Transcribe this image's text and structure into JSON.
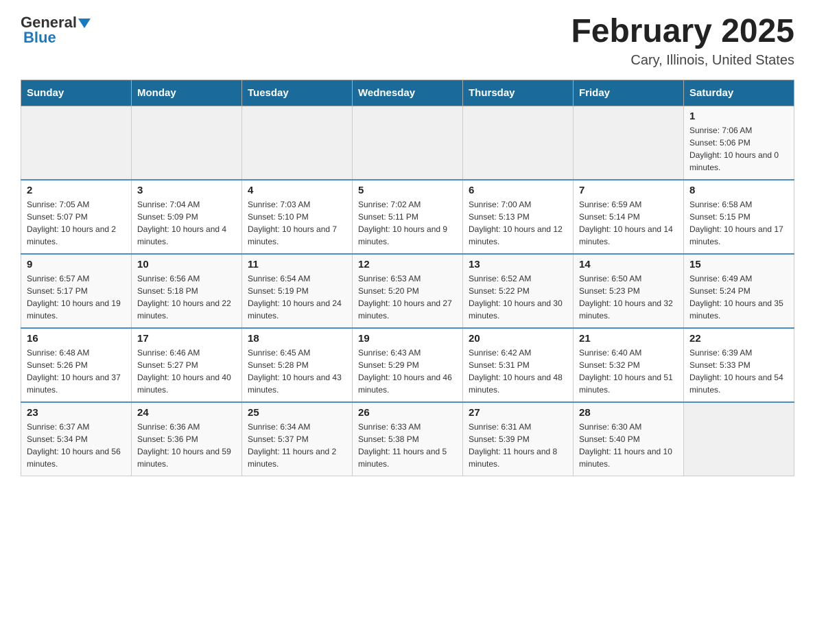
{
  "header": {
    "logo": {
      "general": "General",
      "blue": "Blue",
      "triangle": true
    },
    "title": "February 2025",
    "subtitle": "Cary, Illinois, United States"
  },
  "calendar": {
    "days_of_week": [
      "Sunday",
      "Monday",
      "Tuesday",
      "Wednesday",
      "Thursday",
      "Friday",
      "Saturday"
    ],
    "weeks": [
      {
        "days": [
          {
            "date": "",
            "info": ""
          },
          {
            "date": "",
            "info": ""
          },
          {
            "date": "",
            "info": ""
          },
          {
            "date": "",
            "info": ""
          },
          {
            "date": "",
            "info": ""
          },
          {
            "date": "",
            "info": ""
          },
          {
            "date": "1",
            "info": "Sunrise: 7:06 AM\nSunset: 5:06 PM\nDaylight: 10 hours and 0 minutes."
          }
        ]
      },
      {
        "days": [
          {
            "date": "2",
            "info": "Sunrise: 7:05 AM\nSunset: 5:07 PM\nDaylight: 10 hours and 2 minutes."
          },
          {
            "date": "3",
            "info": "Sunrise: 7:04 AM\nSunset: 5:09 PM\nDaylight: 10 hours and 4 minutes."
          },
          {
            "date": "4",
            "info": "Sunrise: 7:03 AM\nSunset: 5:10 PM\nDaylight: 10 hours and 7 minutes."
          },
          {
            "date": "5",
            "info": "Sunrise: 7:02 AM\nSunset: 5:11 PM\nDaylight: 10 hours and 9 minutes."
          },
          {
            "date": "6",
            "info": "Sunrise: 7:00 AM\nSunset: 5:13 PM\nDaylight: 10 hours and 12 minutes."
          },
          {
            "date": "7",
            "info": "Sunrise: 6:59 AM\nSunset: 5:14 PM\nDaylight: 10 hours and 14 minutes."
          },
          {
            "date": "8",
            "info": "Sunrise: 6:58 AM\nSunset: 5:15 PM\nDaylight: 10 hours and 17 minutes."
          }
        ]
      },
      {
        "days": [
          {
            "date": "9",
            "info": "Sunrise: 6:57 AM\nSunset: 5:17 PM\nDaylight: 10 hours and 19 minutes."
          },
          {
            "date": "10",
            "info": "Sunrise: 6:56 AM\nSunset: 5:18 PM\nDaylight: 10 hours and 22 minutes."
          },
          {
            "date": "11",
            "info": "Sunrise: 6:54 AM\nSunset: 5:19 PM\nDaylight: 10 hours and 24 minutes."
          },
          {
            "date": "12",
            "info": "Sunrise: 6:53 AM\nSunset: 5:20 PM\nDaylight: 10 hours and 27 minutes."
          },
          {
            "date": "13",
            "info": "Sunrise: 6:52 AM\nSunset: 5:22 PM\nDaylight: 10 hours and 30 minutes."
          },
          {
            "date": "14",
            "info": "Sunrise: 6:50 AM\nSunset: 5:23 PM\nDaylight: 10 hours and 32 minutes."
          },
          {
            "date": "15",
            "info": "Sunrise: 6:49 AM\nSunset: 5:24 PM\nDaylight: 10 hours and 35 minutes."
          }
        ]
      },
      {
        "days": [
          {
            "date": "16",
            "info": "Sunrise: 6:48 AM\nSunset: 5:26 PM\nDaylight: 10 hours and 37 minutes."
          },
          {
            "date": "17",
            "info": "Sunrise: 6:46 AM\nSunset: 5:27 PM\nDaylight: 10 hours and 40 minutes."
          },
          {
            "date": "18",
            "info": "Sunrise: 6:45 AM\nSunset: 5:28 PM\nDaylight: 10 hours and 43 minutes."
          },
          {
            "date": "19",
            "info": "Sunrise: 6:43 AM\nSunset: 5:29 PM\nDaylight: 10 hours and 46 minutes."
          },
          {
            "date": "20",
            "info": "Sunrise: 6:42 AM\nSunset: 5:31 PM\nDaylight: 10 hours and 48 minutes."
          },
          {
            "date": "21",
            "info": "Sunrise: 6:40 AM\nSunset: 5:32 PM\nDaylight: 10 hours and 51 minutes."
          },
          {
            "date": "22",
            "info": "Sunrise: 6:39 AM\nSunset: 5:33 PM\nDaylight: 10 hours and 54 minutes."
          }
        ]
      },
      {
        "days": [
          {
            "date": "23",
            "info": "Sunrise: 6:37 AM\nSunset: 5:34 PM\nDaylight: 10 hours and 56 minutes."
          },
          {
            "date": "24",
            "info": "Sunrise: 6:36 AM\nSunset: 5:36 PM\nDaylight: 10 hours and 59 minutes."
          },
          {
            "date": "25",
            "info": "Sunrise: 6:34 AM\nSunset: 5:37 PM\nDaylight: 11 hours and 2 minutes."
          },
          {
            "date": "26",
            "info": "Sunrise: 6:33 AM\nSunset: 5:38 PM\nDaylight: 11 hours and 5 minutes."
          },
          {
            "date": "27",
            "info": "Sunrise: 6:31 AM\nSunset: 5:39 PM\nDaylight: 11 hours and 8 minutes."
          },
          {
            "date": "28",
            "info": "Sunrise: 6:30 AM\nSunset: 5:40 PM\nDaylight: 11 hours and 10 minutes."
          },
          {
            "date": "",
            "info": ""
          }
        ]
      }
    ]
  }
}
